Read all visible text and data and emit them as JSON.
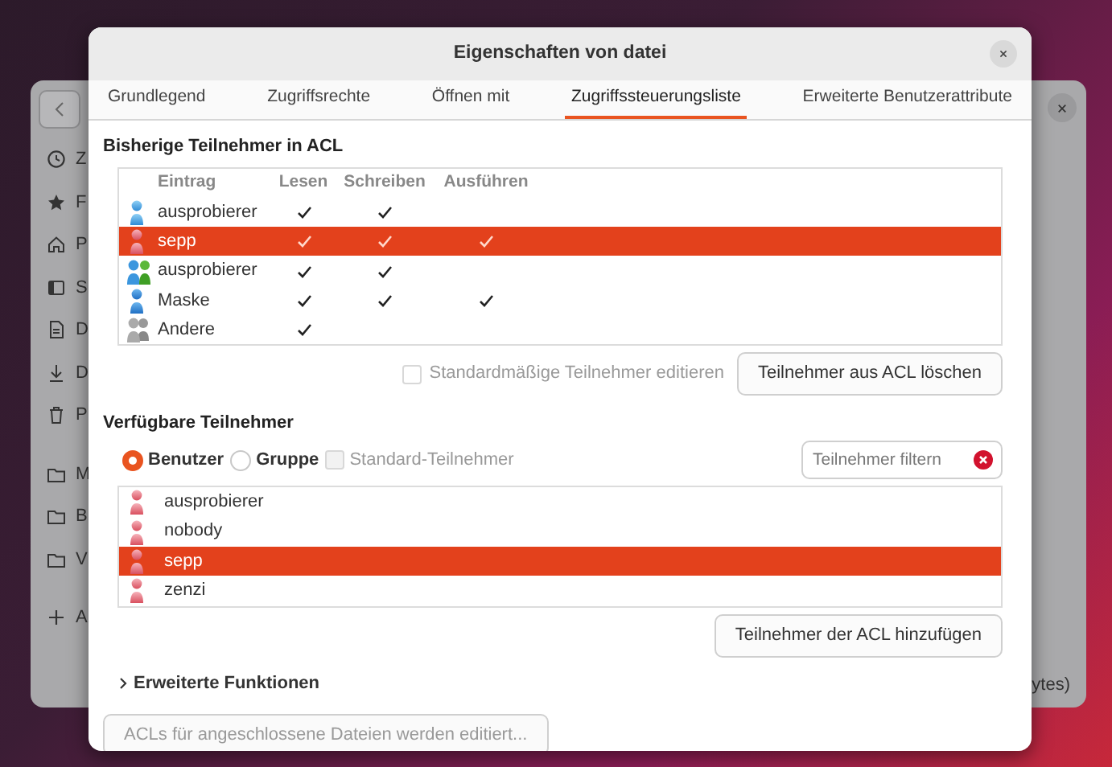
{
  "background_window": {
    "sidebar": [
      {
        "kind": "clock",
        "label": "Z"
      },
      {
        "kind": "star",
        "label": "F"
      },
      {
        "kind": "home",
        "label": "P"
      },
      {
        "kind": "square",
        "label": "S"
      },
      {
        "kind": "document",
        "label": "D"
      },
      {
        "kind": "download",
        "label": "D"
      },
      {
        "kind": "trash",
        "label": "P"
      },
      {
        "kind": "folder",
        "label": "M"
      },
      {
        "kind": "folder",
        "label": "B"
      },
      {
        "kind": "folder",
        "label": "V"
      },
      {
        "kind": "plus",
        "label": "A"
      }
    ],
    "status_text": "ytes)"
  },
  "dialog": {
    "title": "Eigenschaften von datei",
    "tabs": [
      {
        "label": "Grundlegend",
        "selected": false
      },
      {
        "label": "Zugriffsrechte",
        "selected": false
      },
      {
        "label": "Öffnen mit",
        "selected": false
      },
      {
        "label": "Zugriffssteuerungsliste",
        "selected": true
      },
      {
        "label": "Erweiterte Benutzerattribute",
        "selected": false
      }
    ],
    "acl": {
      "heading": "Bisherige Teilnehmer in ACL",
      "columns": [
        "Eintrag",
        "Lesen",
        "Schreiben",
        "Ausführen"
      ],
      "rows": [
        {
          "kind": "user",
          "name": "ausprobierer",
          "read": true,
          "write": true,
          "execute": false,
          "selected": false
        },
        {
          "kind": "owner",
          "name": "sepp",
          "read": true,
          "write": true,
          "execute": true,
          "selected": true
        },
        {
          "kind": "group",
          "name": "ausprobierer",
          "read": true,
          "write": true,
          "execute": false,
          "selected": false
        },
        {
          "kind": "mask",
          "name": "Maske",
          "read": true,
          "write": true,
          "execute": true,
          "selected": false
        },
        {
          "kind": "other",
          "name": "Andere",
          "read": true,
          "write": false,
          "execute": false,
          "selected": false
        }
      ],
      "edit_defaults": {
        "label": "Standardmäßige Teilnehmer editieren",
        "checked": false,
        "disabled": true
      },
      "remove_button": "Teilnehmer aus ACL löschen"
    },
    "available": {
      "heading": "Verfügbare Teilnehmer",
      "options": [
        {
          "kind": "radio",
          "label": "Benutzer",
          "selected": true
        },
        {
          "kind": "radio",
          "label": "Gruppe",
          "selected": false
        },
        {
          "kind": "checkbox",
          "label": "Standard-Teilnehmer",
          "checked": false,
          "disabled": true
        }
      ],
      "filter": {
        "placeholder": "Teilnehmer filtern"
      },
      "users": [
        {
          "name": "ausprobierer",
          "selected": false
        },
        {
          "name": "nobody",
          "selected": false
        },
        {
          "name": "sepp",
          "selected": true
        },
        {
          "name": "zenzi",
          "selected": false
        }
      ],
      "add_button": "Teilnehmer der ACL hinzufügen"
    },
    "expander": {
      "label": "Erweiterte Funktionen",
      "expanded": false
    },
    "bottom_button": {
      "label": "ACLs für angeschlossene Dateien werden editiert...",
      "disabled": true
    }
  }
}
